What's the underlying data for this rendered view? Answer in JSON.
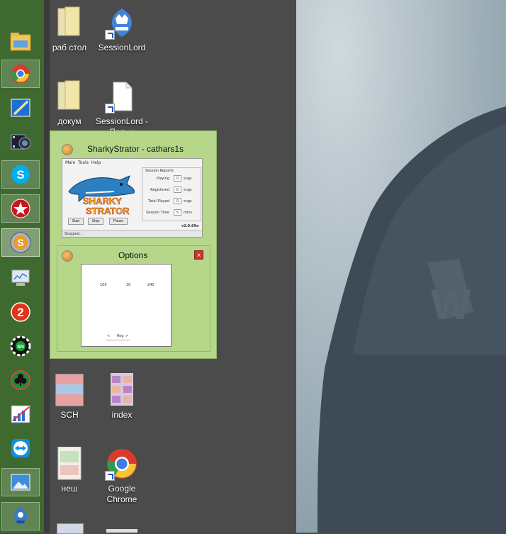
{
  "taskbar": {
    "items": [
      {
        "icon": "file-explorer-icon"
      },
      {
        "icon": "chrome-icon"
      },
      {
        "icon": "pencil-tool-icon"
      },
      {
        "icon": "video-camera-icon"
      },
      {
        "icon": "skype-icon"
      },
      {
        "icon": "pokerstars-icon"
      },
      {
        "icon": "sharkystrator-icon"
      },
      {
        "icon": "monitor-icon"
      },
      {
        "icon": "number-two-icon"
      },
      {
        "icon": "poker-chip-icon"
      },
      {
        "icon": "club-suit-icon"
      },
      {
        "icon": "chart-icon"
      },
      {
        "icon": "teamviewer-icon"
      },
      {
        "icon": "picture-icon"
      },
      {
        "icon": "sessionlord-icon"
      }
    ]
  },
  "desktop": {
    "icons": [
      {
        "label": "раб стол",
        "icon": "folder-icon"
      },
      {
        "label": "SessionLord",
        "icon": "sessionlord-crown-icon"
      },
      {
        "label": "докум",
        "icon": "folder-icon"
      },
      {
        "label": "SessionLord -",
        "label2": "Ярлык",
        "icon": "document-icon"
      },
      {
        "label": "SCH",
        "icon": "spreadsheet-icon"
      },
      {
        "label": "index",
        "icon": "image-grid-icon"
      },
      {
        "label": "неш",
        "icon": "chart-document-icon"
      },
      {
        "label": "Google",
        "label2": "Chrome",
        "icon": "chrome-icon"
      }
    ]
  },
  "preview": {
    "window1": {
      "title": "SharkyStrator - cathars1s",
      "menu": [
        "Main",
        "Tools",
        "Help"
      ],
      "logo_line1": "SHARKY",
      "logo_line2": "STRATOR",
      "reports_title": "Session Reports",
      "rows": [
        {
          "label": "Playing",
          "value": "0",
          "unit": "sngs"
        },
        {
          "label": "Registered",
          "value": "0",
          "unit": "sngs"
        },
        {
          "label": "Total Played",
          "value": "0",
          "unit": "sngs"
        },
        {
          "label": "Session Time",
          "value": "5",
          "unit": "mins"
        }
      ],
      "buttons": [
        "Start",
        "Stop",
        "Pause"
      ],
      "status": "Stopped...",
      "version": "v2.0.69o"
    },
    "window2": {
      "title": "Options",
      "close": "×",
      "mini_labels": [
        "100",
        "30",
        "240"
      ],
      "mini_buttons": [
        "<",
        "Reg",
        ">"
      ]
    }
  },
  "colors": {
    "taskbar": "#3f6a2f",
    "preview_bg": "#b6d78a",
    "close_button": "#c8332d"
  }
}
